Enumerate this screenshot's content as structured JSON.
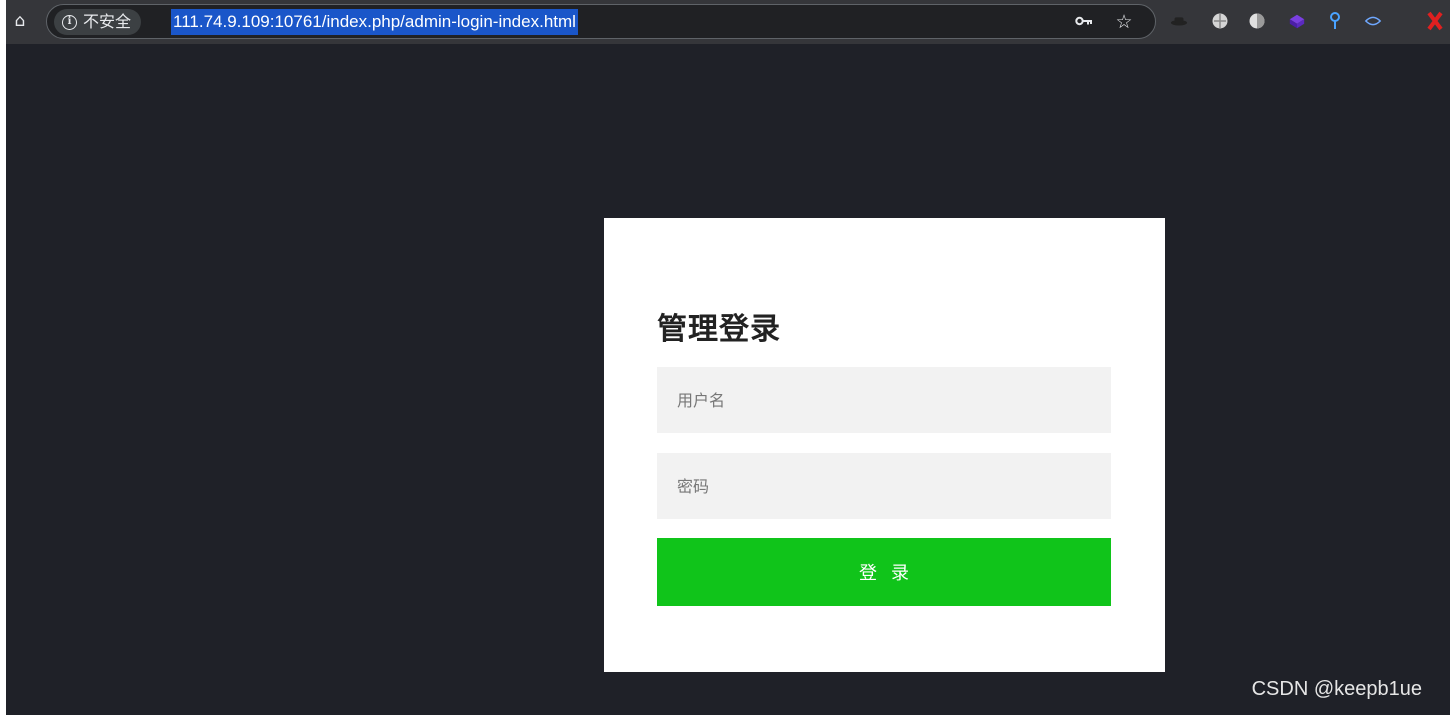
{
  "browser": {
    "home_icon": "home-icon",
    "security_label": "不安全",
    "url": "111.74.9.109:10761/index.php/admin-login-index.html",
    "icons": [
      "info-icon",
      "key-icon",
      "star-icon",
      "hat-extension-icon",
      "sphere-extension-icon",
      "globe-extension-icon",
      "cube-extension-icon",
      "pin-extension-icon",
      "eye-extension-icon",
      "x-extension-icon"
    ]
  },
  "login": {
    "title": "管理登录",
    "username_placeholder": "用户名",
    "password_placeholder": "密码",
    "submit_label": "登录"
  },
  "watermark": "CSDN @keepb1ue",
  "colors": {
    "background": "#1f2128",
    "card": "#ffffff",
    "input_bg": "#f2f2f2",
    "button": "#10c41a",
    "url_highlight": "#1a56c9"
  }
}
